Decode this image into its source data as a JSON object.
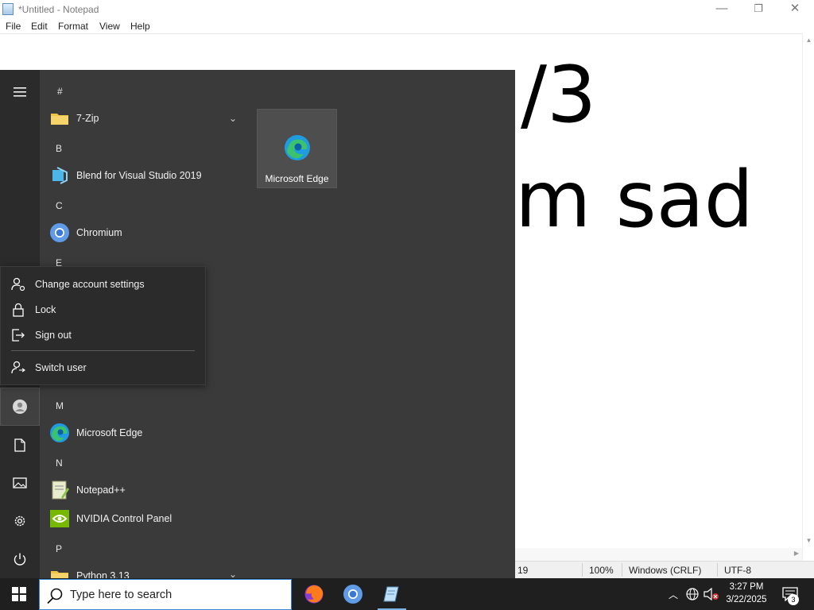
{
  "window": {
    "title": "*Untitled - Notepad",
    "controls": {
      "minimize": "—",
      "maximize": "❐",
      "close": "✕"
    }
  },
  "menubar": [
    "File",
    "Edit",
    "Format",
    "View",
    "Help"
  ],
  "editor": {
    "line1": "/3",
    "line2": "m sad"
  },
  "statusbar": {
    "position": "19",
    "zoom": "100%",
    "line_ending": "Windows (CRLF)",
    "encoding": "UTF-8"
  },
  "startmenu": {
    "rail": {
      "menu": "hamburger-icon",
      "account": "user-account-icon",
      "documents": "document-icon",
      "pictures": "pictures-icon",
      "settings": "gear-icon",
      "power": "power-icon"
    },
    "groups": [
      {
        "letter": "#",
        "apps": [
          {
            "label": "7-Zip",
            "icon": "folder-icon",
            "expandable": true
          }
        ]
      },
      {
        "letter": "B",
        "apps": [
          {
            "label": "Blend for Visual Studio 2019",
            "icon": "blend-icon"
          }
        ]
      },
      {
        "letter": "C",
        "apps": [
          {
            "label": "Chromium",
            "icon": "chromium-icon"
          }
        ]
      },
      {
        "letter": "E",
        "apps": []
      },
      {
        "letter": "M",
        "apps": [
          {
            "label": "Microsoft Edge",
            "icon": "edge-icon"
          }
        ]
      },
      {
        "letter": "N",
        "apps": [
          {
            "label": "Notepad++",
            "icon": "notepadpp-icon"
          },
          {
            "label": "NVIDIA Control Panel",
            "icon": "nvidia-icon"
          }
        ]
      },
      {
        "letter": "P",
        "apps": [
          {
            "label": "Python 3.13",
            "icon": "folder-icon",
            "expandable": true
          }
        ]
      }
    ],
    "tile": {
      "label": "Microsoft Edge",
      "icon": "edge-icon"
    }
  },
  "account_flyout": {
    "items": [
      {
        "label": "Change account settings",
        "icon": "account-settings-icon"
      },
      {
        "label": "Lock",
        "icon": "lock-icon"
      },
      {
        "label": "Sign out",
        "icon": "sign-out-icon"
      },
      {
        "label": "Switch user",
        "icon": "switch-user-icon"
      }
    ]
  },
  "taskbar": {
    "search_placeholder": "Type here to search",
    "apps": [
      "firefox-icon",
      "chromium-icon",
      "notepad-icon"
    ],
    "clock": {
      "time": "3:27 PM",
      "date": "3/22/2025"
    },
    "notifications_count": "3"
  },
  "colors": {
    "start_bg": "#3a3a3a",
    "rail_bg": "#2b2b2b",
    "taskbar_bg": "#1f1f1f",
    "accent": "#3a87d6"
  }
}
